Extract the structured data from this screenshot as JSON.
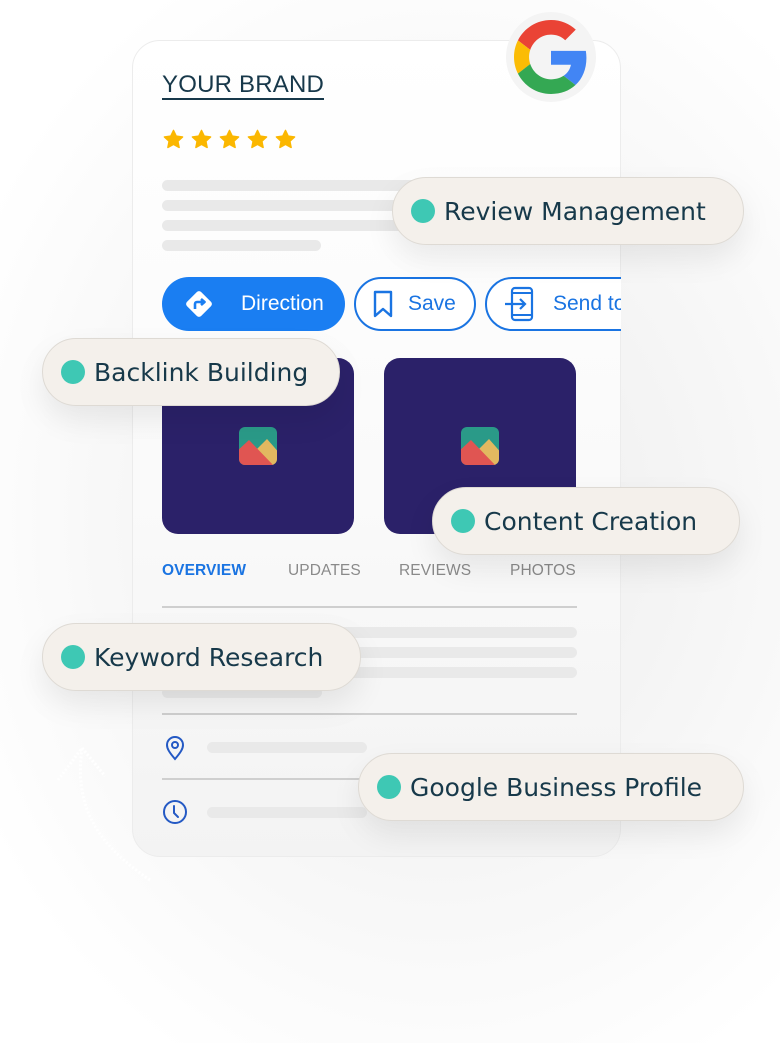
{
  "brand": {
    "title": "YOUR BRAND",
    "rating_stars": 5,
    "rating_max": 5,
    "badge_icon": "google-g-logo"
  },
  "actions": [
    {
      "label": "Direction",
      "icon": "directions-icon",
      "variant": "filled"
    },
    {
      "label": "Save",
      "icon": "bookmark-icon",
      "variant": "outline"
    },
    {
      "label": "Send to",
      "icon": "send-to-phone-icon",
      "variant": "outline",
      "clipped": true
    }
  ],
  "photos": [
    {
      "icon": "image-placeholder-icon"
    },
    {
      "icon": "image-placeholder-icon"
    }
  ],
  "tabs": [
    {
      "label": "OVERVIEW",
      "active": true
    },
    {
      "label": "UPDATES",
      "active": false
    },
    {
      "label": "REVIEWS",
      "active": false
    },
    {
      "label": "PHOTOS",
      "active": false
    }
  ],
  "info_rows": [
    {
      "icon": "location-pin-icon"
    },
    {
      "icon": "clock-icon"
    }
  ],
  "services": [
    {
      "label": "Review Management"
    },
    {
      "label": "Backlink Building"
    },
    {
      "label": "Content Creation"
    },
    {
      "label": "Keyword Research"
    },
    {
      "label": "Google Business Profile"
    }
  ],
  "colors": {
    "accent_blue": "#1a7ef2",
    "outline_blue": "#1a74e2",
    "brand_text": "#17384a",
    "star": "#fbb700",
    "pill_bg": "#f4f0eb",
    "pill_dot": "#3ec8b4",
    "tile_bg": "#2b2169"
  }
}
